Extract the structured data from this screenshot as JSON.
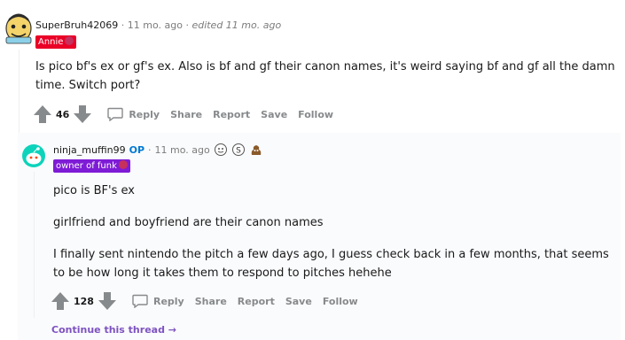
{
  "comment1": {
    "username": "SuperBruh42069",
    "separator1": "·",
    "time": "11 mo. ago",
    "separator2": "·",
    "edited": "edited 11 mo. ago",
    "flair": "Annie",
    "body_line1": "Is pico bf's ex or gf's ex. Also is bf and gf their canon names, it's weird saying bf and gf all the damn",
    "body_line2": "time. Switch port?",
    "votes": "46",
    "actions": {
      "reply": "Reply",
      "share": "Share",
      "report": "Report",
      "save": "Save",
      "follow": "Follow"
    }
  },
  "comment2": {
    "username": "ninja_muffin99",
    "op_badge": "OP",
    "separator": "·",
    "time": "11 mo. ago",
    "flair": "owner of funk",
    "para1": "pico is BF's ex",
    "para2": "girlfriend and boyfriend are their canon names",
    "para3_line1": "I finally sent nintendo the pitch a few days ago, I guess check back in a few months, that seems",
    "para3_line2": "to be how long it takes them to respond to pitches hehehe",
    "votes": "128",
    "actions": {
      "reply": "Reply",
      "share": "Share",
      "report": "Report",
      "save": "Save",
      "follow": "Follow"
    }
  },
  "continue_thread": "Continue this thread",
  "colors": {
    "op": "#0079d3",
    "flair_annie": "#ea0027",
    "flair_funk": "#7e1bd6",
    "link": "#7e53c1"
  }
}
